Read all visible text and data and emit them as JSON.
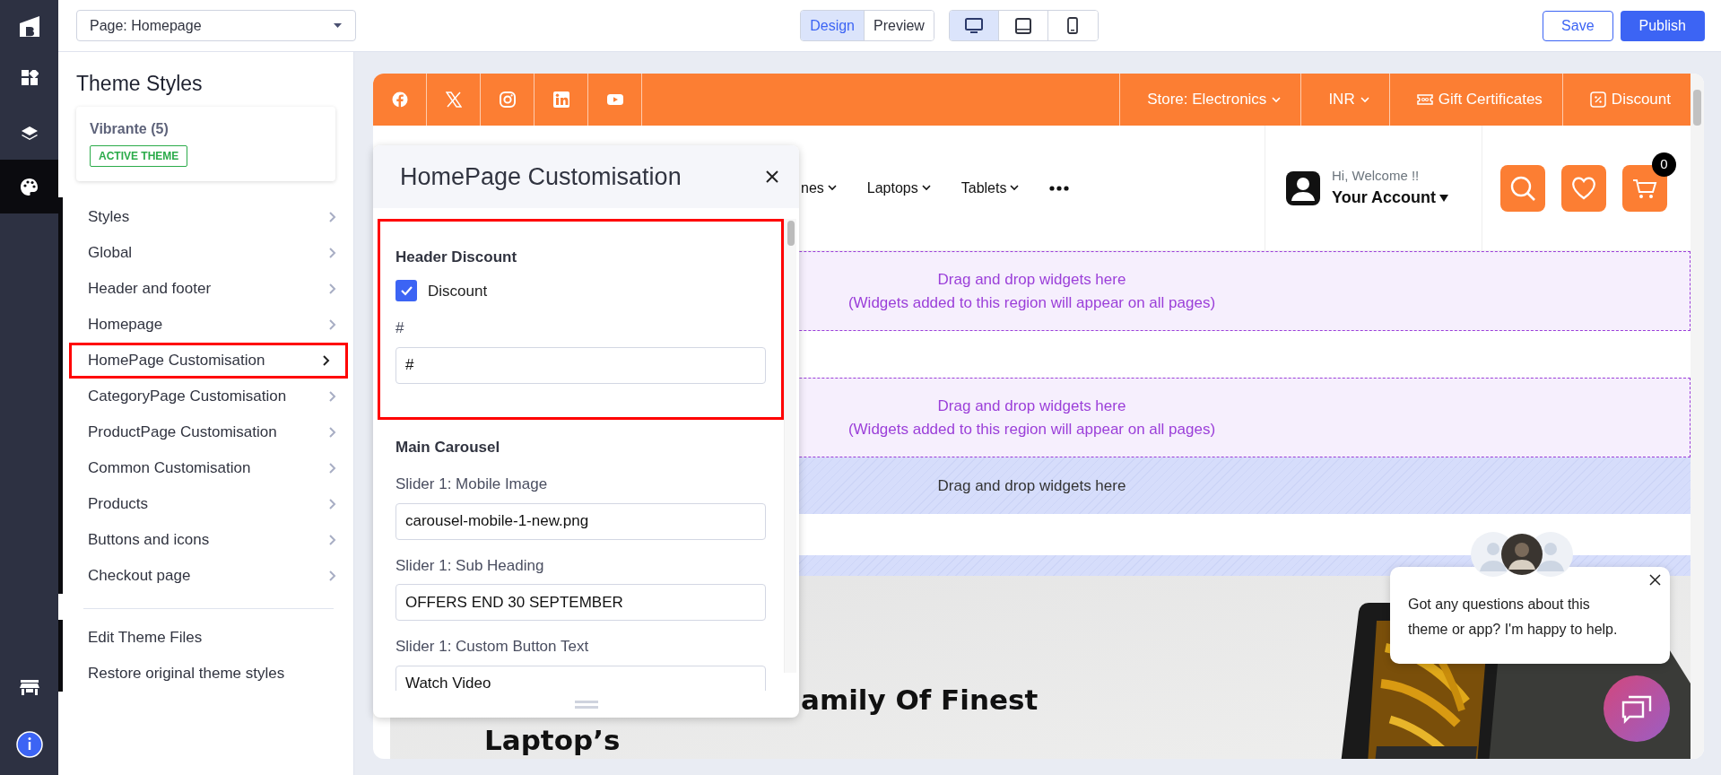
{
  "rail": {
    "items": [
      {
        "kind": "widgets",
        "selected": false
      },
      {
        "kind": "layers",
        "selected": false
      },
      {
        "kind": "palette",
        "selected": true
      }
    ],
    "bottom_items": [
      {
        "kind": "store"
      },
      {
        "kind": "info"
      }
    ]
  },
  "topbar": {
    "page_select": "Page: Homepage",
    "view_modes": [
      {
        "label": "Design",
        "selected": true
      },
      {
        "label": "Preview",
        "selected": false
      }
    ],
    "devices": [
      {
        "kind": "desktop",
        "selected": true
      },
      {
        "kind": "tablet",
        "selected": false
      },
      {
        "kind": "mobile",
        "selected": false
      }
    ],
    "save": "Save",
    "publish": "Publish"
  },
  "sidebar": {
    "title": "Theme Styles",
    "theme": {
      "name": "Vibrante (5)",
      "badge": "ACTIVE THEME"
    },
    "items": [
      {
        "label": "Styles",
        "highlighted": false
      },
      {
        "label": "Global",
        "highlighted": false
      },
      {
        "label": "Header and footer",
        "highlighted": false
      },
      {
        "label": "Homepage",
        "highlighted": false
      },
      {
        "label": "HomePage Customisation",
        "highlighted": true
      },
      {
        "label": "CategoryPage Customisation",
        "highlighted": false
      },
      {
        "label": "ProductPage Customisation",
        "highlighted": false
      },
      {
        "label": "Common Customisation",
        "highlighted": false
      },
      {
        "label": "Products",
        "highlighted": false
      },
      {
        "label": "Buttons and icons",
        "highlighted": false
      },
      {
        "label": "Checkout page",
        "highlighted": false
      }
    ],
    "links": [
      "Edit Theme Files",
      "Restore original theme styles"
    ]
  },
  "preview": {
    "social": [
      {
        "kind": "facebook"
      },
      {
        "kind": "x"
      },
      {
        "kind": "instagram"
      },
      {
        "kind": "linkedin"
      },
      {
        "kind": "youtube"
      }
    ],
    "top_links": [
      {
        "label": "Store: Electronics",
        "kind": "dropdown"
      },
      {
        "label": "INR",
        "kind": "dropdown"
      },
      {
        "label": "Gift Certificates",
        "kind": "ticket"
      },
      {
        "label": "Discount",
        "kind": "percent"
      }
    ],
    "nav": [
      "nes",
      "Laptops",
      "Tablets"
    ],
    "account": {
      "greeting": "Hi, Welcome !!",
      "label": "Your Account"
    },
    "cart_count": "0",
    "drop_zones": [
      {
        "kind": "global",
        "lines": [
          "Drag and drop widgets here",
          "(Widgets added to this region will appear on all pages)"
        ]
      },
      {
        "kind": "global",
        "lines": [
          "Drag and drop widgets here",
          "(Widgets added to this region will appear on all pages)"
        ]
      },
      {
        "kind": "page",
        "lines": [
          "Drag and drop widgets here"
        ]
      }
    ],
    "hero": {
      "lines": [
        "amily Of Finest",
        "Laptop’s"
      ]
    }
  },
  "panel": {
    "title": "HomePage Customisation",
    "sections": [
      {
        "heading": "Header Discount",
        "highlighted": true,
        "fields": [
          {
            "kind": "checkbox",
            "label": "Discount",
            "checked": true
          },
          {
            "kind": "text",
            "label": "#",
            "value": "#"
          }
        ]
      },
      {
        "heading": "Main Carousel",
        "highlighted": false,
        "fields": [
          {
            "kind": "text",
            "label": "Slider 1: Mobile Image",
            "value": "carousel-mobile-1-new.png"
          },
          {
            "kind": "text",
            "label": "Slider 1: Sub Heading",
            "value": "OFFERS END 30 SEPTEMBER"
          },
          {
            "kind": "text",
            "label": "Slider 1: Custom Button Text",
            "value": "Watch Video"
          }
        ]
      }
    ]
  },
  "chat": {
    "message": "Got any questions about this theme or app? I'm happy to help."
  }
}
